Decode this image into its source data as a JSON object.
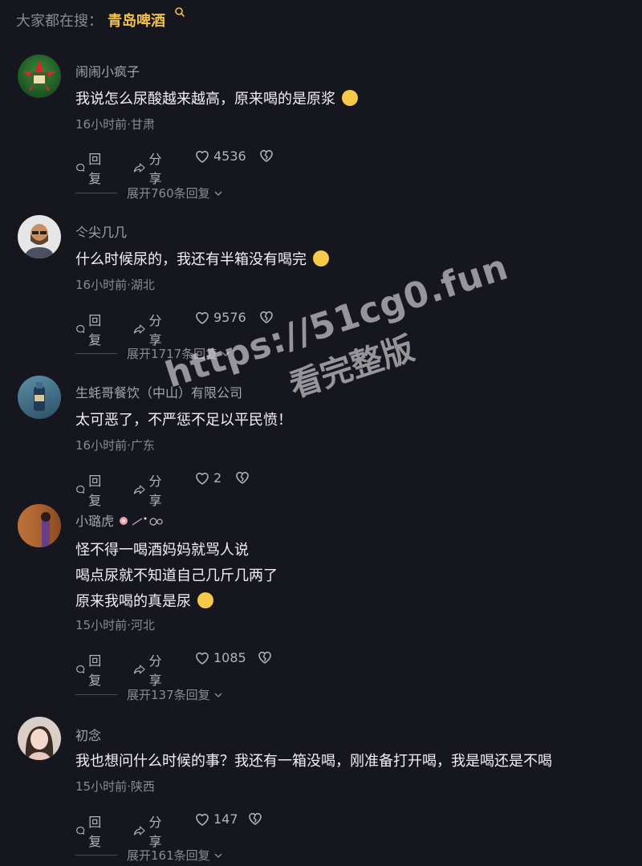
{
  "search": {
    "label": "大家都在搜：",
    "term": "青岛啤酒"
  },
  "comments": [
    {
      "name": "闹闹小疯子",
      "lines": [
        "我说怎么尿酸越来越高，原来喝的是原浆"
      ],
      "meta": "16小时前·甘肃",
      "reply_label": "回复",
      "share_label": "分享",
      "likes": "4536",
      "expand": "展开760条回复"
    },
    {
      "name": "仒尖几几",
      "lines": [
        "什么时候尿的，我还有半箱没有喝完"
      ],
      "meta": "16小时前·湖北",
      "reply_label": "回复",
      "share_label": "分享",
      "likes": "9576",
      "expand": "展开1717条回复"
    },
    {
      "name": "生蚝哥餐饮（中山）有限公司",
      "lines": [
        "太可恶了，不严惩不足以平民愤！"
      ],
      "meta": "16小时前·广东",
      "reply_label": "回复",
      "share_label": "分享",
      "likes": "2",
      "expand": ""
    },
    {
      "name": "小璐虎",
      "lines": [
        "怪不得一喝酒妈妈就骂人说",
        "喝点尿就不知道自己几斤几两了",
        "原来我喝的真是尿"
      ],
      "meta": "15小时前·河北",
      "reply_label": "回复",
      "share_label": "分享",
      "likes": "1085",
      "expand": "展开137条回复"
    },
    {
      "name": "初念",
      "lines": [
        "我也想问什么时候的事？我还有一箱没喝，刚准备打开喝，我是喝还是不喝"
      ],
      "meta": "15小时前·陕西",
      "reply_label": "回复",
      "share_label": "分享",
      "likes": "147",
      "expand": "展开161条回复"
    }
  ],
  "watermark": {
    "line1": "https://51cg0.fun",
    "line2": "看完整版"
  }
}
